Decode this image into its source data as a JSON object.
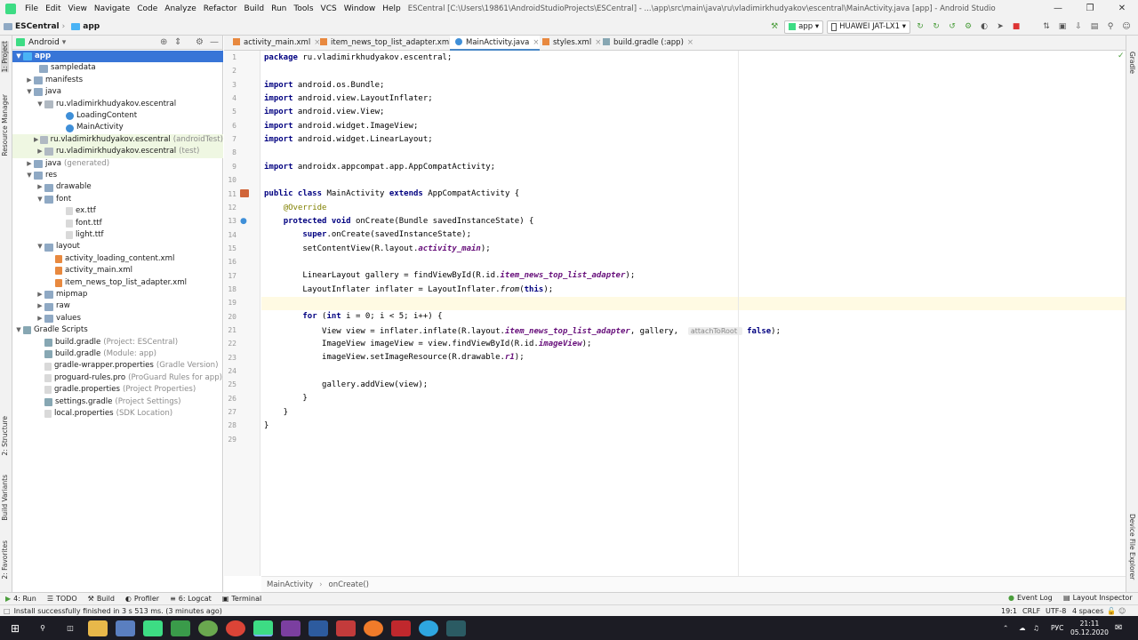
{
  "menu": {
    "items": [
      "File",
      "Edit",
      "View",
      "Navigate",
      "Code",
      "Analyze",
      "Refactor",
      "Build",
      "Run",
      "Tools",
      "VCS",
      "Window",
      "Help"
    ],
    "title": "ESCentral [C:\\Users\\19861\\AndroidStudioProjects\\ESCentral] - ...\\app\\src\\main\\java\\ru\\vladimirkhudyakov\\escentral\\MainActivity.java [app] - Android Studio"
  },
  "nav": {
    "project": "ESCentral",
    "module": "app",
    "run_config": "app",
    "device": "HUAWEI JAT-LX1"
  },
  "project_panel": {
    "view": "Android",
    "tree": [
      {
        "label": "app",
        "hint": "",
        "sel": true,
        "grn": false
      },
      {
        "label": "sampledata",
        "hint": "",
        "sel": false,
        "grn": false
      },
      {
        "label": "manifests",
        "hint": "",
        "sel": false,
        "grn": false
      },
      {
        "label": "java",
        "hint": "",
        "sel": false,
        "grn": false
      },
      {
        "label": "ru.vladimirkhudyakov.escentral",
        "hint": "",
        "sel": false,
        "grn": false
      },
      {
        "label": "LoadingContent",
        "hint": "",
        "sel": false,
        "grn": false
      },
      {
        "label": "MainActivity",
        "hint": "",
        "sel": false,
        "grn": false
      },
      {
        "label": "ru.vladimirkhudyakov.escentral",
        "hint": "(androidTest)",
        "sel": false,
        "grn": true
      },
      {
        "label": "ru.vladimirkhudyakov.escentral",
        "hint": "(test)",
        "sel": false,
        "grn": true
      },
      {
        "label": "java",
        "hint": "(generated)",
        "sel": false,
        "grn": false
      },
      {
        "label": "res",
        "hint": "",
        "sel": false,
        "grn": false
      },
      {
        "label": "drawable",
        "hint": "",
        "sel": false,
        "grn": false
      },
      {
        "label": "font",
        "hint": "",
        "sel": false,
        "grn": false
      },
      {
        "label": "ex.ttf",
        "hint": "",
        "sel": false,
        "grn": false
      },
      {
        "label": "font.ttf",
        "hint": "",
        "sel": false,
        "grn": false
      },
      {
        "label": "light.ttf",
        "hint": "",
        "sel": false,
        "grn": false
      },
      {
        "label": "layout",
        "hint": "",
        "sel": false,
        "grn": false
      },
      {
        "label": "activity_loading_content.xml",
        "hint": "",
        "sel": false,
        "grn": false
      },
      {
        "label": "activity_main.xml",
        "hint": "",
        "sel": false,
        "grn": false
      },
      {
        "label": "item_news_top_list_adapter.xml",
        "hint": "",
        "sel": false,
        "grn": false
      },
      {
        "label": "mipmap",
        "hint": "",
        "sel": false,
        "grn": false
      },
      {
        "label": "raw",
        "hint": "",
        "sel": false,
        "grn": false
      },
      {
        "label": "values",
        "hint": "",
        "sel": false,
        "grn": false
      },
      {
        "label": "Gradle Scripts",
        "hint": "",
        "sel": false,
        "grn": false
      },
      {
        "label": "build.gradle",
        "hint": "(Project: ESCentral)",
        "sel": false,
        "grn": false
      },
      {
        "label": "build.gradle",
        "hint": "(Module: app)",
        "sel": false,
        "grn": false
      },
      {
        "label": "gradle-wrapper.properties",
        "hint": "(Gradle Version)",
        "sel": false,
        "grn": false
      },
      {
        "label": "proguard-rules.pro",
        "hint": "(ProGuard Rules for app)",
        "sel": false,
        "grn": false
      },
      {
        "label": "gradle.properties",
        "hint": "(Project Properties)",
        "sel": false,
        "grn": false
      },
      {
        "label": "settings.gradle",
        "hint": "(Project Settings)",
        "sel": false,
        "grn": false
      },
      {
        "label": "local.properties",
        "hint": "(SDK Location)",
        "sel": false,
        "grn": false
      }
    ]
  },
  "tabs": [
    {
      "label": "activity_main.xml",
      "active": false
    },
    {
      "label": "item_news_top_list_adapter.xml",
      "active": false
    },
    {
      "label": "MainActivity.java",
      "active": true
    },
    {
      "label": "styles.xml",
      "active": false
    },
    {
      "label": "build.gradle (:app)",
      "active": false
    }
  ],
  "editor": {
    "line_numbers": [
      "1",
      "2",
      "3",
      "4",
      "5",
      "6",
      "7",
      "8",
      "9",
      "10",
      "11",
      "12",
      "13",
      "14",
      "15",
      "16",
      "17",
      "18",
      "19",
      "20",
      "21",
      "22",
      "23",
      "24",
      "25",
      "26",
      "27",
      "28",
      "29"
    ],
    "inlay_hint": "attachToRoot:"
  },
  "breadcrumb": {
    "class": "MainActivity",
    "method": "onCreate()"
  },
  "tool_windows": {
    "left": [
      "4: Run",
      "TODO",
      "Build",
      "Profiler",
      "6: Logcat",
      "Terminal"
    ],
    "right": [
      "Event Log",
      "Layout Inspector"
    ]
  },
  "side_tabs": {
    "left": [
      "1: Project",
      "Resource Manager",
      "2: Structure",
      "Build Variants",
      "2: Favorites"
    ],
    "right": [
      "Gradle",
      "Device File Explorer"
    ]
  },
  "status": {
    "message": "Install successfully finished in 3 s 513 ms. (3 minutes ago)",
    "position": "19:1",
    "line_sep": "CRLF",
    "encoding": "UTF-8",
    "indent": "4 spaces"
  },
  "taskbar": {
    "lang": "РУС",
    "time": "21:11",
    "date": "05.12.2020"
  }
}
